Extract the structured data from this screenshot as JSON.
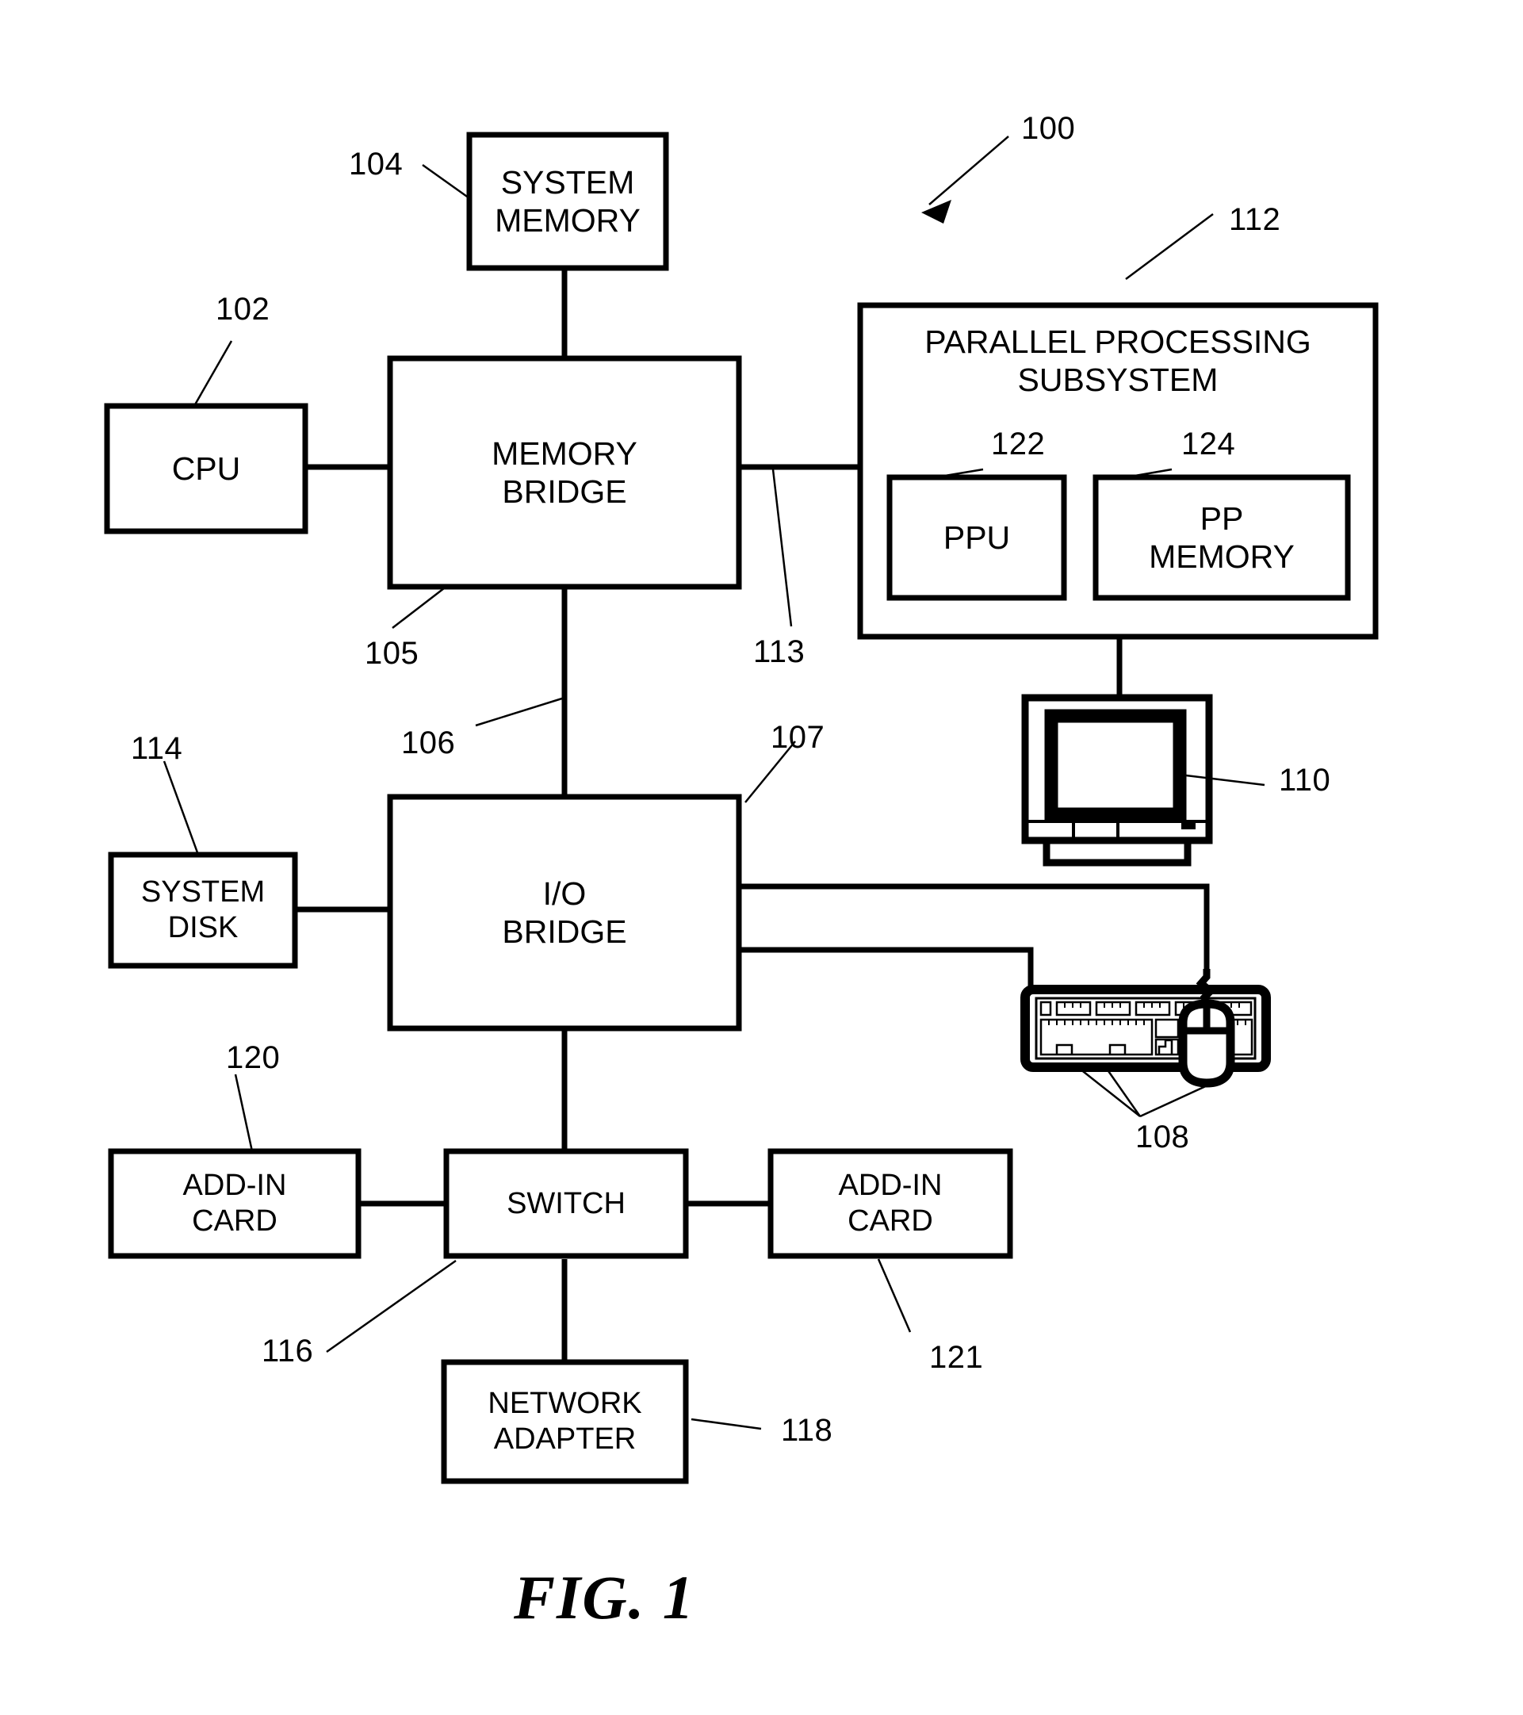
{
  "figure": {
    "caption": "FIG. 1",
    "system_ref": "100"
  },
  "blocks": {
    "system_memory": {
      "label": "SYSTEM\nMEMORY",
      "ref": "104"
    },
    "cpu": {
      "label": "CPU",
      "ref": "102"
    },
    "memory_bridge": {
      "label": "MEMORY\nBRIDGE",
      "ref": "105"
    },
    "parallel_processing_subsystem": {
      "label": "PARALLEL PROCESSING\nSUBSYSTEM",
      "ref": "112"
    },
    "ppu": {
      "label": "PPU",
      "ref": "122"
    },
    "pp_memory": {
      "label": "PP\nMEMORY",
      "ref": "124"
    },
    "display_device": {
      "label": "",
      "ref": "110"
    },
    "io_bridge": {
      "label": "I/O\nBRIDGE",
      "ref": "107"
    },
    "system_disk": {
      "label": "SYSTEM\nDISK",
      "ref": "114"
    },
    "input_devices": {
      "label": "",
      "ref": "108"
    },
    "add_in_card_left": {
      "label": "ADD-IN\nCARD",
      "ref": "120"
    },
    "switch": {
      "label": "SWITCH",
      "ref": "116"
    },
    "add_in_card_right": {
      "label": "ADD-IN\nCARD",
      "ref": "121"
    },
    "network_adapter": {
      "label": "NETWORK\nADAPTER",
      "ref": "118"
    }
  },
  "connections": {
    "memory_bridge_to_ppsubsystem": {
      "ref": "113"
    },
    "memory_bridge_to_io_bridge": {
      "ref": "106"
    }
  },
  "colors": {
    "line": "#000000",
    "background": "#ffffff"
  }
}
